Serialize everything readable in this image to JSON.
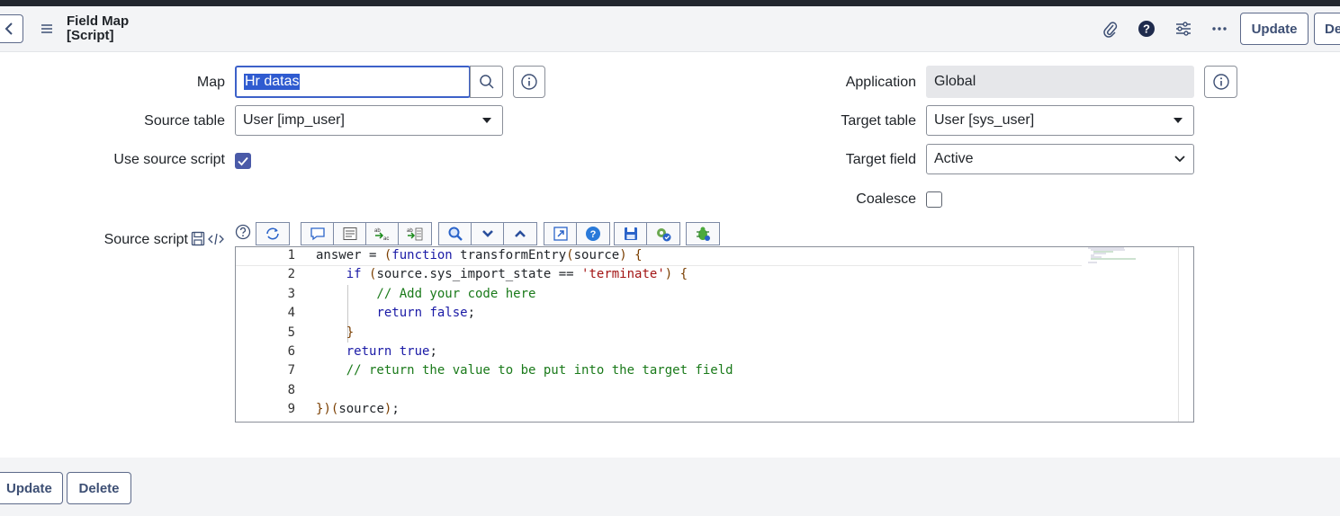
{
  "header": {
    "title_line1": "Field Map",
    "title_line2": "[Script]",
    "update_label": "Update",
    "delete_label_truncated": "De"
  },
  "form": {
    "map": {
      "label": "Map",
      "value": "Hr datas"
    },
    "application": {
      "label": "Application",
      "value": "Global"
    },
    "source_table": {
      "label": "Source table",
      "value": "User [imp_user]"
    },
    "target_table": {
      "label": "Target table",
      "value": "User [sys_user]"
    },
    "use_source_script": {
      "label": "Use source script",
      "checked": true
    },
    "target_field": {
      "label": "Target field",
      "value": "Active"
    },
    "coalesce": {
      "label": "Coalesce",
      "checked": false
    },
    "source_script": {
      "label": "Source script"
    }
  },
  "editor": {
    "line_numbers": [
      "1",
      "2",
      "3",
      "4",
      "5",
      "6",
      "7",
      "8",
      "9"
    ],
    "lines": [
      "answer = (function transformEntry(source) {",
      "    if (source.sys_import_state == 'terminate') {",
      "        // Add your code here",
      "        return false;",
      "    }",
      "    return true;",
      "    // return the value to be put into the target field",
      "",
      "})(source);"
    ]
  },
  "toolbar": {
    "buttons": [
      "format-code-icon",
      "comment-icon",
      "list-icon",
      "replace-icon",
      "replace-all-icon",
      "search-icon",
      "fold-down-icon",
      "fold-up-icon",
      "fullscreen-icon",
      "help-icon",
      "save-icon",
      "script-debug-icon",
      "debug-icon"
    ]
  },
  "footer": {
    "update_label": "Update",
    "delete_label": "Delete"
  },
  "colors": {
    "accent": "#3d61c9",
    "checkbox": "#4a5aa8",
    "button_text": "#3d4f74",
    "topbar": "#22262e"
  }
}
